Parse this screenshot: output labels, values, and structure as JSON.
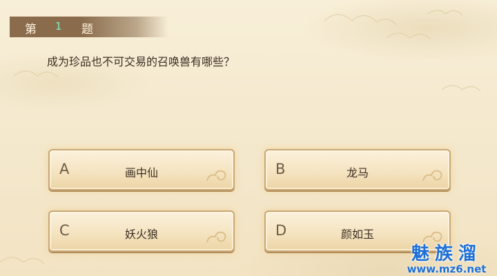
{
  "question_header": {
    "prefix": "第",
    "number": "1",
    "suffix": "题"
  },
  "question": {
    "text": "成为珍品也不可交易的召唤兽有哪些？"
  },
  "options": [
    {
      "letter": "A",
      "label": "画中仙"
    },
    {
      "letter": "B",
      "label": "龙马"
    },
    {
      "letter": "C",
      "label": "妖火狼"
    },
    {
      "letter": "D",
      "label": "颜如玉"
    }
  ],
  "watermark": {
    "title": "魅族溜",
    "url": "www.mz6.net"
  },
  "colors": {
    "header_bar": "#8a6c4c",
    "question_number": "#7ff0c8",
    "option_border": "#c9a675",
    "watermark": "#1d6fd6"
  }
}
